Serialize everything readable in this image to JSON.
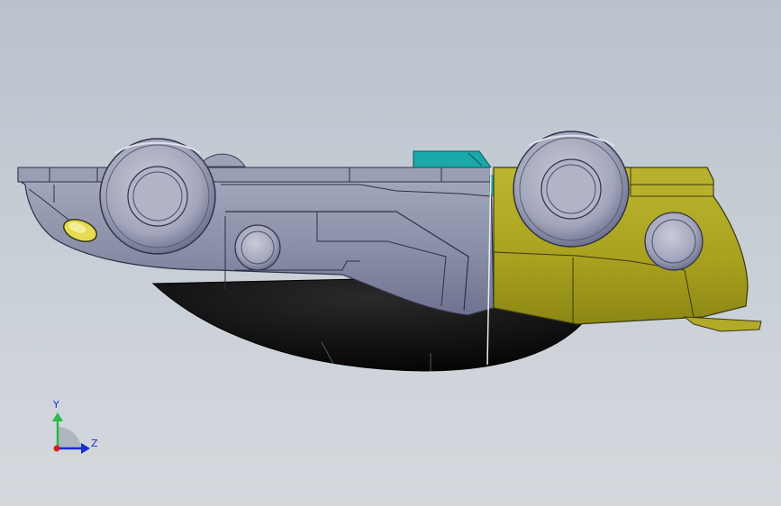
{
  "viewport": {
    "background_top": "#b9c2cc",
    "background_bottom": "#d4d9de"
  },
  "model": {
    "body_color": "#8e92aa",
    "underside_color": "#0c0c0c",
    "highlight_part_color": "#aaa520",
    "accent_part_color": "#1aa8a8",
    "lamp_color": "#e8de55"
  },
  "triad": {
    "y_label": "Y",
    "z_label": "Z",
    "y_axis_color": "#2db84a",
    "z_axis_color": "#1a2ecc",
    "origin_color": "#d02020"
  }
}
